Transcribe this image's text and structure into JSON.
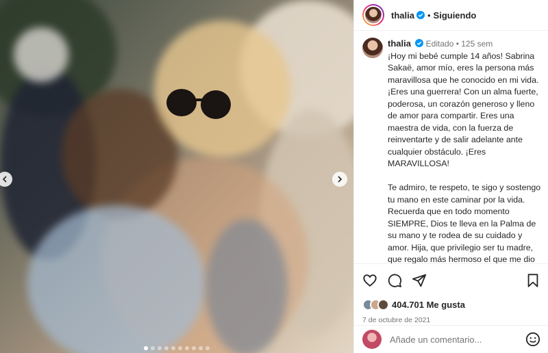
{
  "post": {
    "username": "thalia",
    "follow_status": "Siguiendo",
    "separator": "•"
  },
  "caption": {
    "username": "thalia",
    "edited": "Editado",
    "age": "125 sem",
    "text": "¡Hoy mi bebé cumple 14 años! Sabrina Sakaë, amor mío, eres la persona más maravillosa que he conocido en mi vida. ¡Eres una guerrera! Con un alma fuerte, poderosa, un corazón generoso y lleno de amor para compartir. Eres una maestra de vida, con la fuerza de reinventarte y de salir adelante ante cualquier obstáculo. ¡Eres MARAVILLOSA!\n\nTe admiro, te respeto, te sigo y sostengo tu mano en este caminar por la vida. Recuerda que en todo momento SIEMPRE, Dios te lleva en la Palma de su mano y te rodea de su cuidado y amor. Hija, que privilegio ser tu madre, que regalo más hermoso el que me dio mi Señor al haberme elegido para ser la madre de"
  },
  "engagement": {
    "likes": "404.701 Me gusta",
    "date": "7 de octubre de 2021"
  },
  "comment": {
    "placeholder": "Añade un comentario..."
  },
  "carousel": {
    "total_slides": 10,
    "active_index": 0
  },
  "icons": {
    "verified": "verified-badge-icon",
    "like": "heart-icon",
    "comment": "comment-icon",
    "share": "share-icon",
    "save": "bookmark-icon",
    "emoji": "emoji-icon",
    "prev": "chevron-left-icon",
    "next": "chevron-right-icon"
  },
  "colors": {
    "verified": "#0095f6",
    "text": "#262626",
    "muted": "#737373"
  }
}
